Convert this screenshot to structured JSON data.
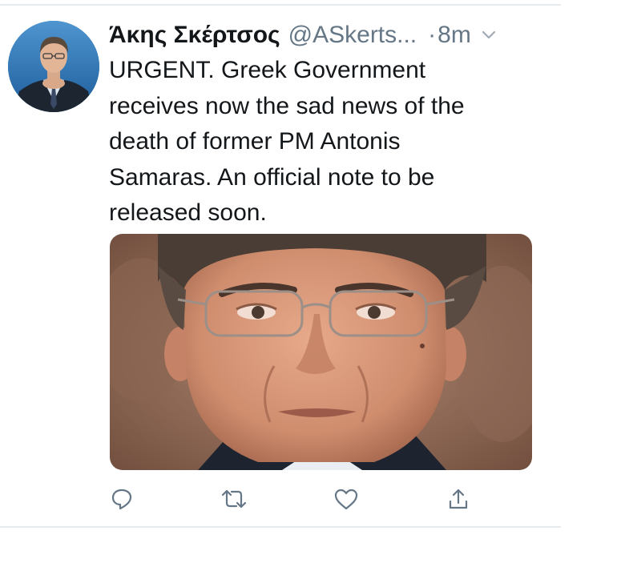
{
  "tweet": {
    "display_name": "Άκης Σκέρτσος",
    "handle": "@ASkerts...",
    "separator": "·",
    "timestamp": "8m",
    "text_lines": [
      "URGENT. Greek Government",
      "receives now the sad news of the",
      "death of former PM Antonis",
      "Samaras. An official note to be",
      "released soon."
    ]
  },
  "icons": {
    "more": "chevron-down-icon",
    "reply": "reply-icon",
    "retweet": "retweet-icon",
    "like": "heart-icon",
    "share": "share-icon"
  },
  "colors": {
    "text": "#14171a",
    "secondary": "#657786",
    "divider": "#e6ecf0",
    "avatar_bg": "#2a6fb0"
  }
}
